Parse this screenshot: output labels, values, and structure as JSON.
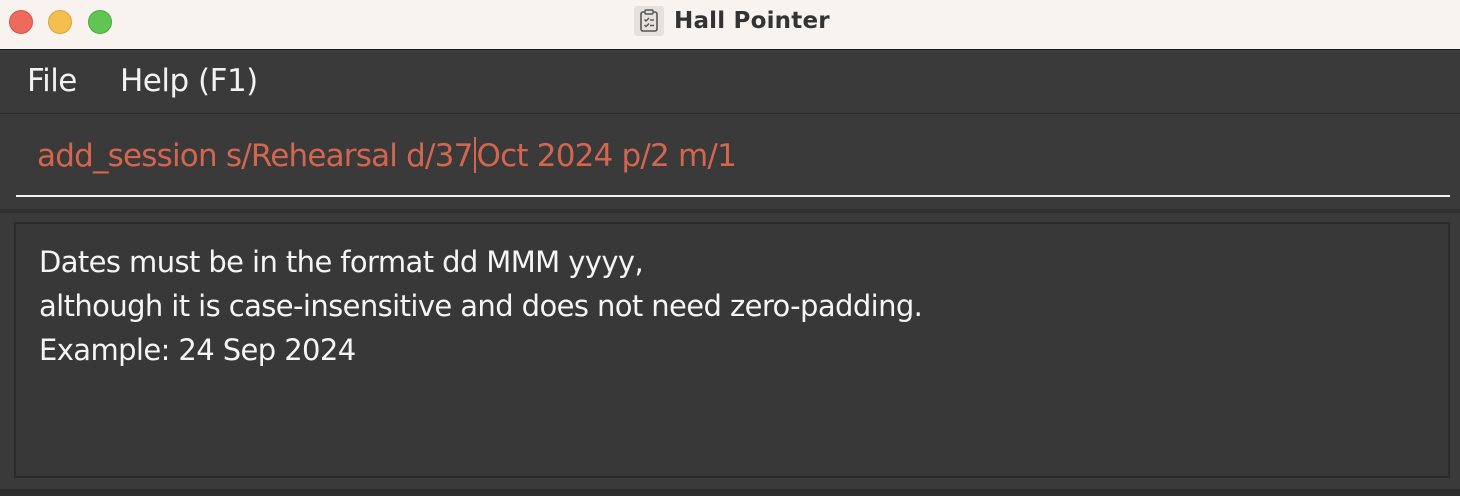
{
  "window": {
    "title": "Hall Pointer",
    "app_icon": "clipboard-icon"
  },
  "menu": {
    "items": [
      {
        "label": "File"
      },
      {
        "label": "Help (F1)"
      }
    ]
  },
  "command_box": {
    "text_before_caret": "add_session s/Rehearsal d/37",
    "text_after_caret": "Oct 2024 p/2 m/1",
    "text_color": "#d4664f"
  },
  "result_display": {
    "lines": [
      "Dates must be in the format dd MMM yyyy,",
      "although it is case-insensitive and does not need zero-padding.",
      "Example: 24 Sep 2024"
    ]
  },
  "colors": {
    "close": "#ed6a5e",
    "minimize": "#f4bf4f",
    "maximize": "#61c554",
    "background": "#3a3a3a",
    "titlebar": "#f8f3ef",
    "error_text": "#d4664f"
  }
}
